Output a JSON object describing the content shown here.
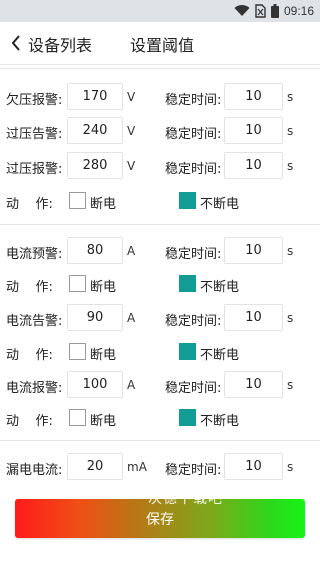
{
  "status_bar": {
    "time": "09:16"
  },
  "header": {
    "back_label": "设备列表",
    "title": "设置阈值"
  },
  "labels": {
    "stable_time": "稳定时间:",
    "action": "动    作:",
    "power_off": "断电",
    "no_power_off": "不断电"
  },
  "voltage": {
    "rows": [
      {
        "label": "欠压报警:",
        "value": "170",
        "unit": "V",
        "stable_value": "10",
        "stable_unit": "s"
      },
      {
        "label": "过压告警:",
        "value": "240",
        "unit": "V",
        "stable_value": "10",
        "stable_unit": "s"
      },
      {
        "label": "过压报警:",
        "value": "280",
        "unit": "V",
        "stable_value": "10",
        "stable_unit": "s"
      }
    ],
    "action": {
      "power_off_checked": false,
      "no_power_off_checked": true
    }
  },
  "current": {
    "rows": [
      {
        "label": "电流预警:",
        "value": "80",
        "unit": "A",
        "stable_value": "10",
        "stable_unit": "s",
        "power_off_checked": false,
        "no_power_off_checked": true
      },
      {
        "label": "电流告警:",
        "value": "90",
        "unit": "A",
        "stable_value": "10",
        "stable_unit": "s",
        "power_off_checked": false,
        "no_power_off_checked": true
      },
      {
        "label": "电流报警:",
        "value": "100",
        "unit": "A",
        "stable_value": "10",
        "stable_unit": "s",
        "power_off_checked": false,
        "no_power_off_checked": true
      }
    ]
  },
  "leakage": {
    "label": "漏电电流:",
    "value": "20",
    "unit": "mA",
    "stable_value": "10",
    "stable_unit": "s"
  },
  "save_button": {
    "label": "保存"
  },
  "watermark": {
    "text": "次德下载吧"
  },
  "colors": {
    "checkbox_checked": "#139c93",
    "save_gradient_start": "#ff1b1b",
    "save_gradient_end": "#16f416"
  }
}
